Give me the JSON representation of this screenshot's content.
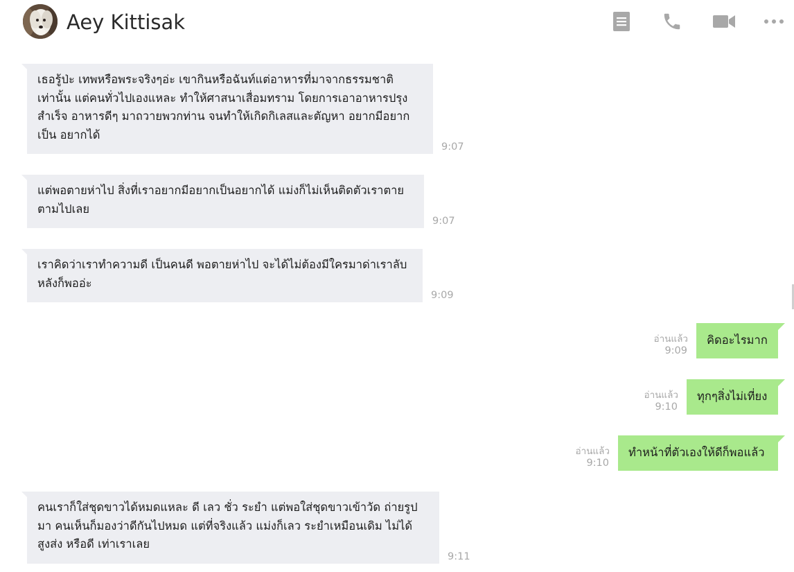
{
  "header": {
    "contact_name": "Aey Kittisak",
    "icons": [
      "notes-icon",
      "phone-icon",
      "video-icon",
      "more-icon"
    ]
  },
  "messages": [
    {
      "direction": "incoming",
      "text": "เธอรู้ป่ะ เทพหรือพระจริงๆอ่ะ เขากินหรือฉันท์แต่อาหารที่มาจากธรรมชาติเท่านั้น แต่คนทั่วไปเองแหละ ทำให้ศาสนาเสื่อมทราม โดยการเอาอาหารปรุงสำเร็จ อาหารดีๆ มาถวายพวกท่าน จนทำให้เกิดกิเลสและตัญหา อยากมีอยากเป็น อยากได้",
      "time": "9:07"
    },
    {
      "direction": "incoming",
      "text": "แต่พอตายห่าไป สิ่งที่เราอยากมีอยากเป็นอยากได้ แม่งก็ไม่เห็นติดตัวเราตายตามไปเลย",
      "time": "9:07"
    },
    {
      "direction": "incoming",
      "text": "เราคิดว่าเราทำความดี เป็นคนดี พอตายห่าไป จะได้ไม่ต้องมีใครมาด่าเราลับหลังก็พออ่ะ",
      "time": "9:09"
    },
    {
      "direction": "outgoing",
      "text": "คิดอะไรมาก",
      "read": "อ่านแล้ว",
      "time": "9:09"
    },
    {
      "direction": "outgoing",
      "text": "ทุกๆสิ่งไม่เที่ยง",
      "read": "อ่านแล้ว",
      "time": "9:10"
    },
    {
      "direction": "outgoing",
      "text": "ทำหน้าที่ตัวเองให้ดีก็พอแล้ว",
      "read": "อ่านแล้ว",
      "time": "9:10"
    },
    {
      "direction": "incoming",
      "text": "คนเราก็ใส่ชุดขาวได้หมดแหละ ดี เลว ชั่ว ระยำ แต่พอใส่ชุดขาวเข้าวัด ถ่ายรูปมา คนเห็นก็มองว่าดีกันไปหมด แต่ที่จริงแล้ว แม่งก็เลว ระยำเหมือนเดิม ไม่ได้สูงส่ง หรือดี เท่าเราเลย",
      "time": "9:11"
    }
  ],
  "colors": {
    "incoming_bubble": "#edeef2",
    "outgoing_bubble": "#a9e98c",
    "meta_text": "#a8a8a8"
  }
}
